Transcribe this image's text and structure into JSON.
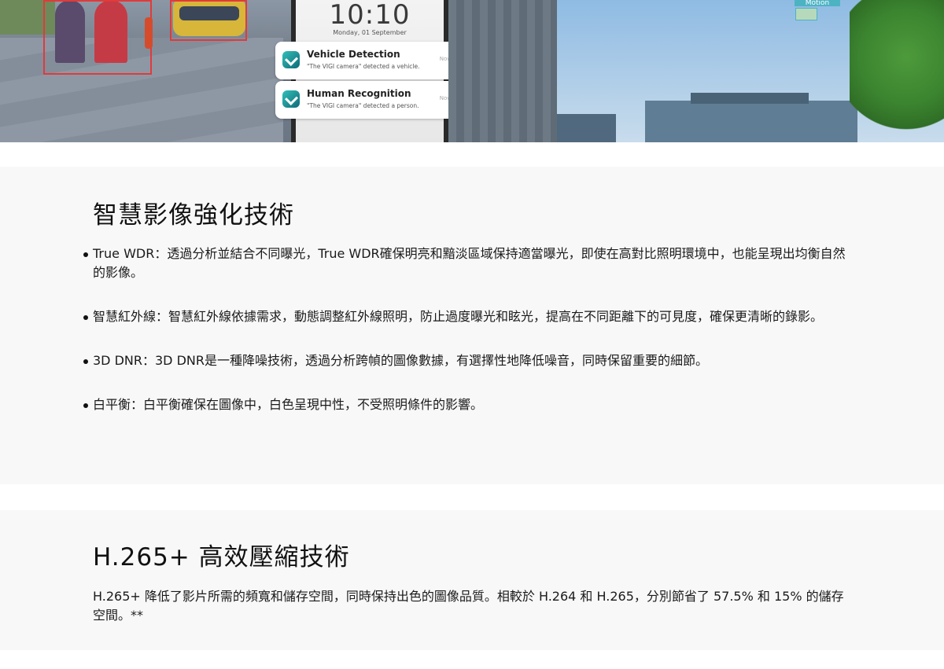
{
  "hero": {
    "clock_time": "10:10",
    "clock_date": "Monday, 01 September",
    "motion_label": "Motion",
    "notifications": [
      {
        "title": "Vehicle Detection",
        "text": "\"The VIGI camera\" detected a vehicle.",
        "time": "Now"
      },
      {
        "title": "Human Recognition",
        "text": "\"The VIGI camera\" detected a person.",
        "time": "Now"
      }
    ]
  },
  "section_smart": {
    "title": "智慧影像強化技術",
    "items": [
      "True WDR：透過分析並結合不同曝光，True WDR確保明亮和黯淡區域保持適當曝光，即使在高對比照明環境中，也能呈現出均衡自然的影像。",
      "智慧紅外線：智慧紅外線依據需求，動態調整紅外線照明，防止過度曝光和眩光，提高在不同距離下的可見度，確保更清晰的錄影。",
      "3D DNR：3D DNR是一種降噪技術，透過分析跨幀的圖像數據，有選擇性地降低噪音，同時保留重要的細節。",
      "白平衡：白平衡確保在圖像中，白色呈現中性，不受照明條件的影響。"
    ]
  },
  "section_h265": {
    "title": "H.265+ 高效壓縮技術",
    "text": "H.265+ 降低了影片所需的頻寬和儲存空間，同時保持出色的圖像品質。相較於 H.264 和 H.265，分別節省了 57.5% 和 15% 的儲存空間。**"
  },
  "colors": {
    "section_bg": "#f8f8f8",
    "detection_box": "#e23a3a",
    "notification_icon": "#33c0b9"
  }
}
